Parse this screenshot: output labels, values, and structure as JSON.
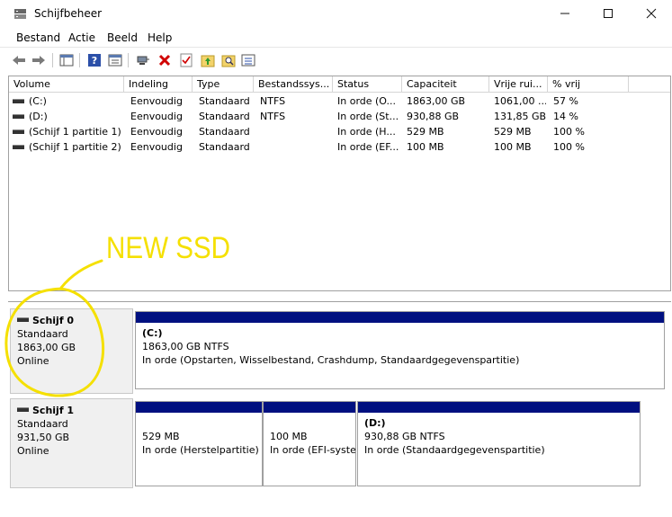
{
  "window": {
    "title": "Schijfbeheer"
  },
  "menu": [
    "Bestand",
    "Actie",
    "Beeld",
    "Help"
  ],
  "toolbar_icons": [
    "back-arrow-icon",
    "forward-arrow-icon",
    "console-tree-icon",
    "help-icon",
    "properties-icon",
    "connect-icon",
    "delete-icon",
    "check-icon",
    "folder-up-icon",
    "search-folder-icon",
    "list-icon"
  ],
  "table": {
    "columns": [
      "Volume",
      "Indeling",
      "Type",
      "Bestandssys...",
      "Status",
      "Capaciteit",
      "Vrije rui...",
      "% vrij"
    ],
    "rows": [
      [
        "(C:)",
        "Eenvoudig",
        "Standaard",
        "NTFS",
        "In orde (O...",
        "1863,00 GB",
        "1061,00 ...",
        "57 %"
      ],
      [
        "(D:)",
        "Eenvoudig",
        "Standaard",
        "NTFS",
        "In orde (St...",
        "930,88 GB",
        "131,85 GB",
        "14 %"
      ],
      [
        "(Schijf 1 partitie 1)",
        "Eenvoudig",
        "Standaard",
        "",
        "In orde (H...",
        "529 MB",
        "529 MB",
        "100 %"
      ],
      [
        "(Schijf 1 partitie 2)",
        "Eenvoudig",
        "Standaard",
        "",
        "In orde (EF...",
        "100 MB",
        "100 MB",
        "100 %"
      ]
    ]
  },
  "disks": [
    {
      "name": "Schijf 0",
      "type": "Standaard",
      "size": "1863,00 GB",
      "state": "Online",
      "partitions": [
        {
          "title": "(C:)",
          "size": "1863,00 GB NTFS",
          "status": "In orde (Opstarten, Wisselbestand, Crashdump, Standaardgegevenspartitie)"
        }
      ]
    },
    {
      "name": "Schijf 1",
      "type": "Standaard",
      "size": "931,50 GB",
      "state": "Online",
      "partitions": [
        {
          "title": "",
          "size": "529 MB",
          "status": "In orde (Herstelpartitie)"
        },
        {
          "title": "",
          "size": "100 MB",
          "status": "In orde (EFI-systeempartitie)"
        },
        {
          "title": "(D:)",
          "size": "930,88 GB NTFS",
          "status": "In orde (Standaardgegevenspartitie)"
        }
      ]
    }
  ],
  "annotation": {
    "text": "NEW SSD",
    "color": "#f5e000"
  },
  "colors": {
    "partition_bar": "#001080"
  }
}
